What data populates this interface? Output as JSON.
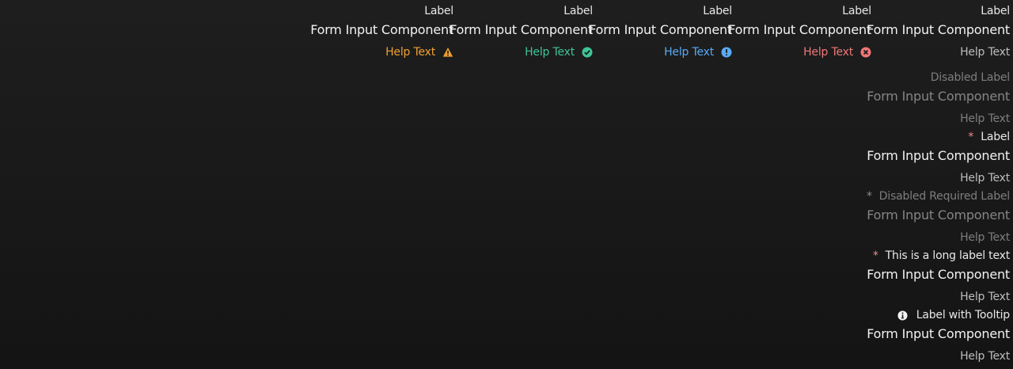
{
  "colors": {
    "background": "#181818",
    "text": "#e8e8e8",
    "warning": "#f0a030",
    "success": "#3fc596",
    "info": "#5aaaf5",
    "error": "#f07777",
    "required_star": "#f08a8a",
    "disabled": "#7e7e7e"
  },
  "row_fields": [
    {
      "label": "Label",
      "value": "Form Input Component",
      "help": "Help Text",
      "status": "warning",
      "status_icon": "warning-triangle-icon"
    },
    {
      "label": "Label",
      "value": "Form Input Component",
      "help": "Help Text",
      "status": "success",
      "status_icon": "check-circle-icon"
    },
    {
      "label": "Label",
      "value": "Form Input Component",
      "help": "Help Text",
      "status": "info",
      "status_icon": "exclamation-circle-icon"
    },
    {
      "label": "Label",
      "value": "Form Input Component",
      "help": "Help Text",
      "status": "error",
      "status_icon": "x-circle-icon"
    },
    {
      "label": "Label",
      "value": "Form Input Component",
      "help": "Help Text",
      "status": "default"
    }
  ],
  "stack_fields": [
    {
      "label": "Disabled Label",
      "value": "Form Input Component",
      "help": "Help Text",
      "disabled": true,
      "required": false
    },
    {
      "label": "Label",
      "value": "Form Input Component",
      "help": "Help Text",
      "disabled": false,
      "required": true,
      "required_mark": "*"
    },
    {
      "label": "Disabled Required Label",
      "value": "Form Input Component",
      "help": "Help Text",
      "disabled": true,
      "required": true,
      "required_mark": "*"
    },
    {
      "label": "This is a long label text",
      "value": "Form Input Component",
      "help": "Help Text",
      "disabled": false,
      "required": true,
      "required_mark": "*"
    },
    {
      "label": "Label with Tooltip",
      "value": "Form Input Component",
      "help": "Help Text",
      "disabled": false,
      "required": false,
      "tooltip_icon": "info-circle-icon"
    }
  ]
}
